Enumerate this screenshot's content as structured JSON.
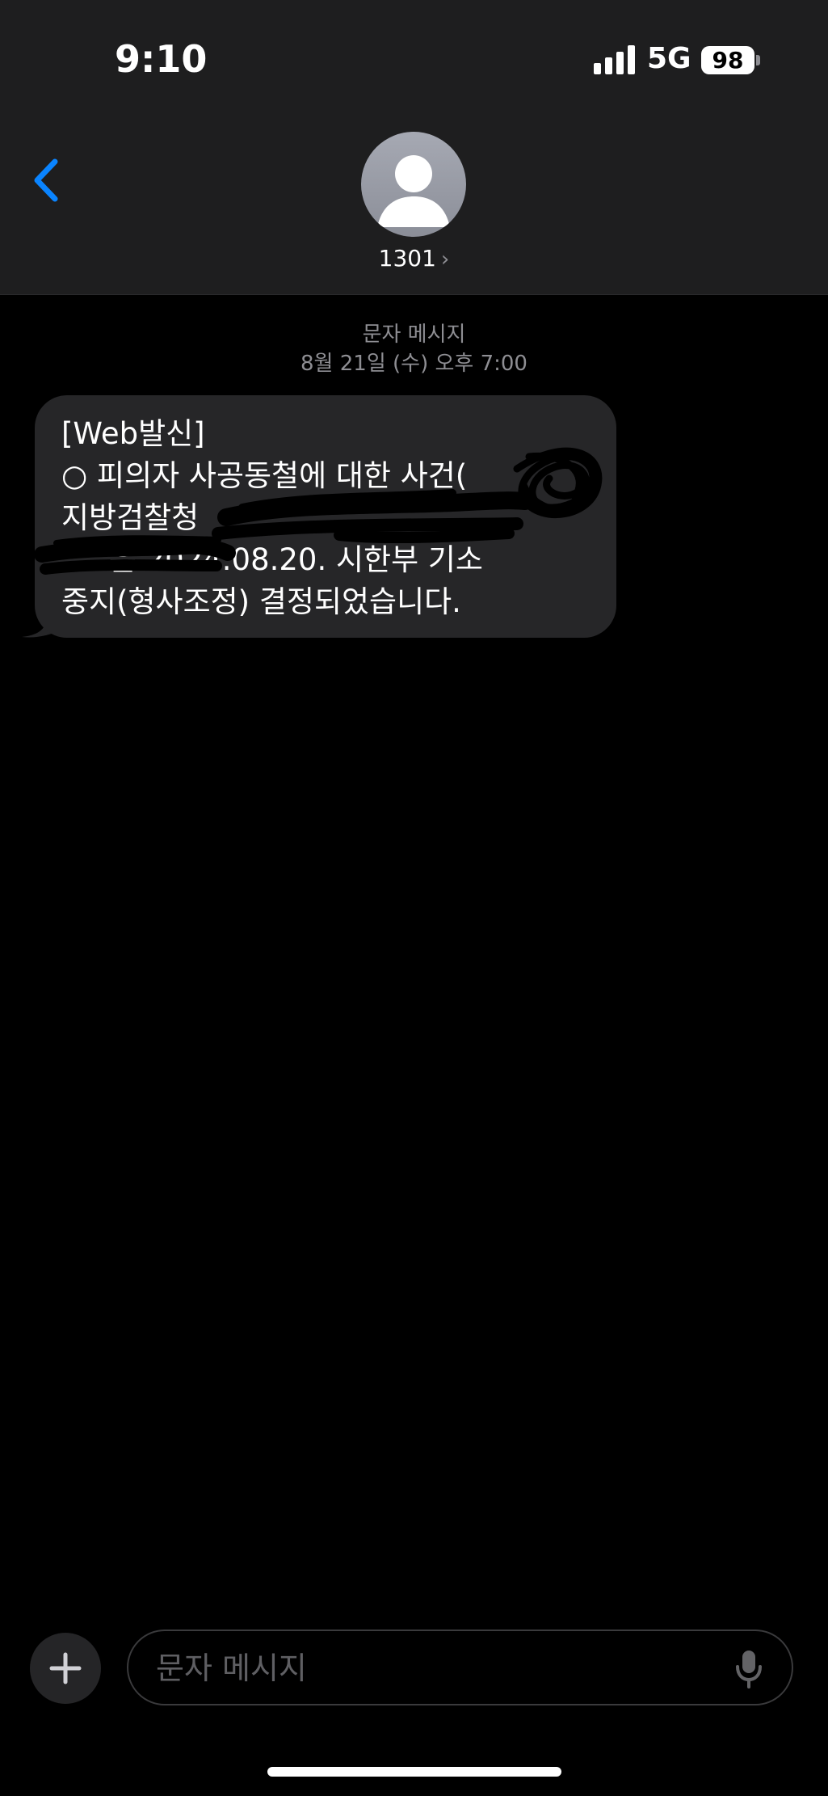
{
  "status_bar": {
    "time": "9:10",
    "network": "5G",
    "battery": "98"
  },
  "header": {
    "contact_name": "1301",
    "icons": {
      "back": "chevron-left-icon",
      "avatar": "person-silhouette-icon",
      "contact_chevron": "chevron-right-icon"
    }
  },
  "thread": {
    "channel_label": "문자 메시지",
    "timestamp": "8월 21일 (수) 오후 7:00",
    "messages": [
      {
        "direction": "incoming",
        "text": "[Web발신]\n○ 피의자 사공동철에 대한 사건(\n지방검찰청 \n     은 2024.08.20. 시한부 기소\n중지(형사조정) 결정되었습니다.",
        "redacted": true
      }
    ]
  },
  "composer": {
    "placeholder": "문자 메시지",
    "value": "",
    "icons": {
      "add": "plus-icon",
      "dictation": "microphone-icon"
    }
  },
  "colors": {
    "accent": "#0a84ff",
    "header_bg": "#1e1e1f",
    "bubble_bg": "#262628",
    "meta_text": "#8e8e93"
  }
}
